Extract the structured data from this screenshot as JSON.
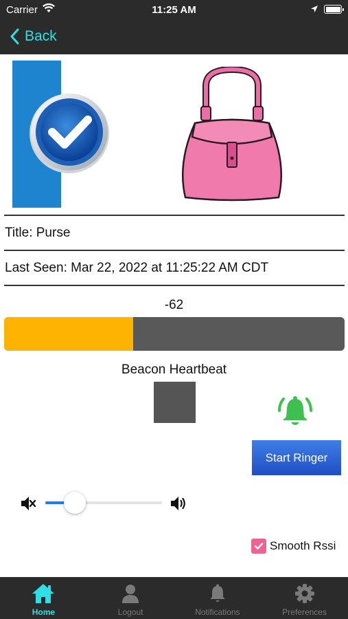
{
  "status_bar": {
    "carrier": "Carrier",
    "time": "11:25 AM"
  },
  "nav": {
    "back_label": "Back"
  },
  "item": {
    "title": "Title: Purse",
    "last_seen": "Last Seen: Mar 22, 2022 at 11:25:22 AM CDT"
  },
  "rssi": {
    "value": "-62",
    "fill_fraction": 0.38
  },
  "heartbeat": {
    "label": "Beacon Heartbeat"
  },
  "ringer": {
    "button_label": "Start Ringer"
  },
  "volume": {
    "level": 0.25
  },
  "smooth_rssi": {
    "label": "Smooth Rssi",
    "checked": true
  },
  "tabs": [
    {
      "label": "Home",
      "icon": "home-icon",
      "active": true
    },
    {
      "label": "Logout",
      "icon": "user-icon",
      "active": false
    },
    {
      "label": "Notifications",
      "icon": "bell-icon",
      "active": false
    },
    {
      "label": "Preferences",
      "icon": "gear-icon",
      "active": false
    }
  ],
  "colors": {
    "accent": "#2ee0e3",
    "progress": "#fdb300",
    "bell": "#3fbf4f",
    "checkbox": "#f06292",
    "button": "#2a5fd6"
  }
}
